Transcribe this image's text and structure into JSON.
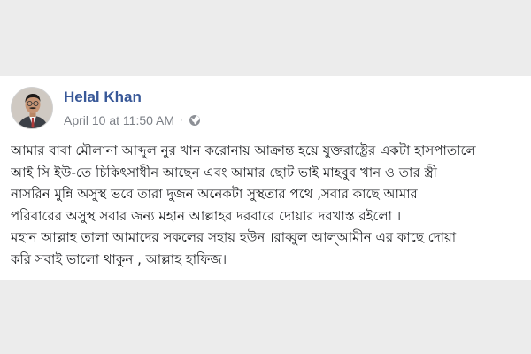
{
  "post": {
    "author": "Helal Khan",
    "timestamp": "April 10 at 11:50 AM",
    "separator": "·",
    "privacy_icon": "globe-icon",
    "avatar_icon": "profile-photo",
    "body_lines": [
      "আমার বাবা মৌলানা আব্দুল নুর খান করোনায় আক্রান্ত হয়ে যুক্তরাষ্ট্রের একটা হাসপাতালে",
      "আই সি ইউ-তে চিকিৎসাধীন আছেন এবং আমার ছোট ভাই মাহবুব খান ও তার স্ত্রী",
      "নাসরিন মুন্নি অসুস্থ ভবে তারা দুজন অনেকটা সুস্থতার পথে ,সবার কাছে আমার",
      "পরিবারের অসুস্থ সবার জন্য মহান আল্লাহর দরবারে দোয়ার দরখাস্ত রইলো ।",
      "মহান আল্লাহ তালা আমাদের সকলের সহায় হউন ।রাব্বুল আল্আমীন এর কাছে দোয়া",
      "করি সবাই ভালো থাকুন , আল্লাহ হাফিজ।"
    ]
  },
  "colors": {
    "author": "#385898",
    "meta": "#7a7e85",
    "text": "#1c1e21",
    "background": "#ececec",
    "card": "#ffffff"
  }
}
